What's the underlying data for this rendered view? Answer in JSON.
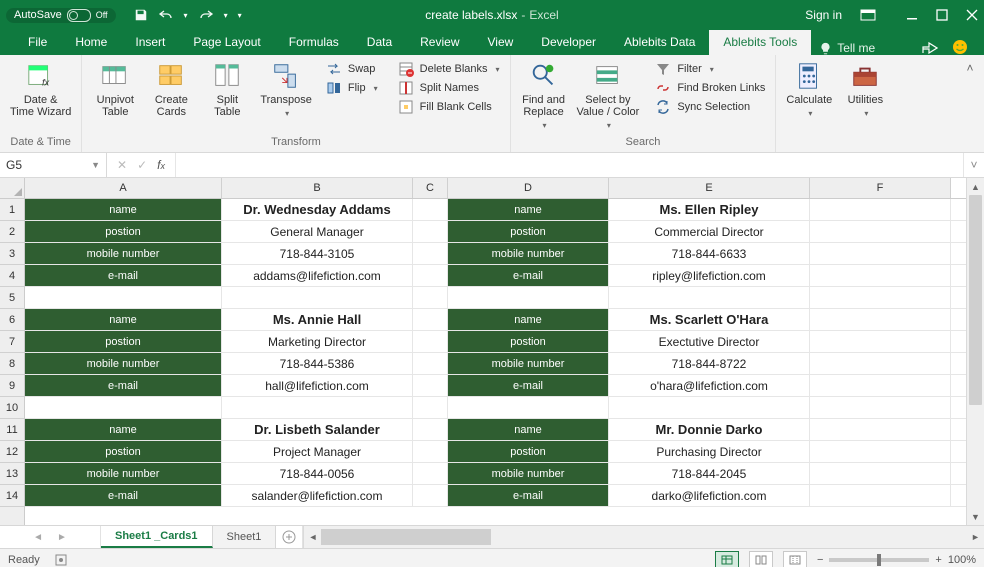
{
  "title": {
    "filename": "create labels.xlsx",
    "sep": "-",
    "app": "Excel",
    "autosave": "AutoSave",
    "autosave_state": "Off",
    "signin": "Sign in"
  },
  "tabs": {
    "file": "File",
    "home": "Home",
    "insert": "Insert",
    "pagelayout": "Page Layout",
    "formulas": "Formulas",
    "data": "Data",
    "review": "Review",
    "view": "View",
    "developer": "Developer",
    "abledata": "Ablebits Data",
    "abletools": "Ablebits Tools",
    "tellme": "Tell me"
  },
  "ribbon": {
    "datetime": {
      "group": "Date & Time",
      "btn": "Date &\nTime Wizard"
    },
    "transform": {
      "group": "Transform",
      "unpivot": "Unpivot\nTable",
      "create": "Create\nCards",
      "split": "Split\nTable",
      "transpose": "Transpose",
      "swap": "Swap",
      "flip": "Flip",
      "delete": "Delete Blanks",
      "splitnames": "Split Names",
      "fill": "Fill Blank Cells"
    },
    "search": {
      "group": "Search",
      "find": "Find and\nReplace",
      "select": "Select by\nValue / Color",
      "filter": "Filter",
      "broken": "Find Broken Links",
      "sync": "Sync Selection"
    },
    "calc": "Calculate",
    "util": "Utilities"
  },
  "fx": {
    "cellref": "G5"
  },
  "cols": [
    "A",
    "B",
    "C",
    "D",
    "E",
    "F"
  ],
  "rownums": [
    1,
    2,
    3,
    4,
    5,
    6,
    7,
    8,
    9,
    10,
    11,
    12,
    13,
    14
  ],
  "labels": {
    "name": "name",
    "position": "postion",
    "mobile": "mobile number",
    "email": "e-mail"
  },
  "cards": [
    {
      "name": "Dr. Wednesday Addams",
      "position": "General Manager",
      "mobile": "718-844-3105",
      "email": "addams@lifefiction.com"
    },
    {
      "name": "Ms. Ellen Ripley",
      "position": "Commercial Director",
      "mobile": "718-844-6633",
      "email": "ripley@lifefiction.com"
    },
    {
      "name": "Ms. Annie Hall",
      "position": "Marketing Director",
      "mobile": "718-844-5386",
      "email": "hall@lifefiction.com"
    },
    {
      "name": "Ms. Scarlett O'Hara",
      "position": "Exectutive Director",
      "mobile": "718-844-8722",
      "email": "o'hara@lifefiction.com"
    },
    {
      "name": "Dr. Lisbeth Salander",
      "position": "Project Manager",
      "mobile": "718-844-0056",
      "email": "salander@lifefiction.com"
    },
    {
      "name": "Mr. Donnie Darko",
      "position": "Purchasing Director",
      "mobile": "718-844-2045",
      "email": "darko@lifefiction.com"
    }
  ],
  "sheets": {
    "active": "Sheet1 _Cards1",
    "other": "Sheet1"
  },
  "status": {
    "ready": "Ready",
    "zoom": "100%"
  }
}
